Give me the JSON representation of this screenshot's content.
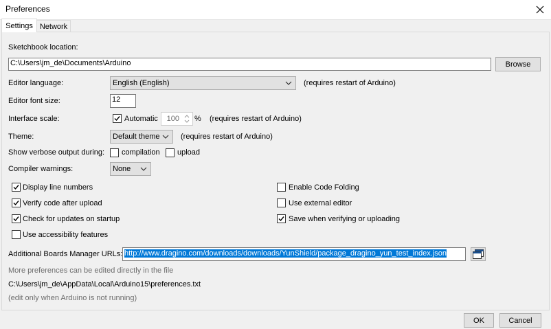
{
  "window": {
    "title": "Preferences"
  },
  "tabs": [
    {
      "label": "Settings",
      "active": true
    },
    {
      "label": "Network",
      "active": false
    }
  ],
  "settings": {
    "sketchbook_label": "Sketchbook location:",
    "sketchbook_path": "C:\\Users\\jm_de\\Documents\\Arduino",
    "browse_label": "Browse",
    "editor_language_label": "Editor language:",
    "editor_language_value": "English (English)",
    "restart_note": "(requires restart of Arduino)",
    "font_size_label": "Editor font size:",
    "font_size_value": "12",
    "interface_scale_label": "Interface scale:",
    "automatic_label": "Automatic",
    "automatic_checked": true,
    "scale_value": "100",
    "percent": "%",
    "theme_label": "Theme:",
    "theme_value": "Default theme",
    "verbose_label": "Show verbose output during:",
    "compilation_label": "compilation",
    "upload_label": "upload",
    "compiler_warnings_label": "Compiler warnings:",
    "compiler_warnings_value": "None",
    "checkboxes_left": [
      {
        "label": "Display line numbers",
        "checked": true
      },
      {
        "label": "Verify code after upload",
        "checked": true
      },
      {
        "label": "Check for updates on startup",
        "checked": true
      },
      {
        "label": "Use accessibility features",
        "checked": false
      }
    ],
    "checkboxes_right": [
      {
        "label": "Enable Code Folding",
        "checked": false
      },
      {
        "label": "Use external editor",
        "checked": false
      },
      {
        "label": "Save when verifying or uploading",
        "checked": true
      }
    ],
    "boards_urls_label": "Additional Boards Manager URLs:",
    "boards_urls_value": "http://www.dragino.com/downloads/downloads/YunShield/package_dragino_yun_test_index.json",
    "more_prefs_note": "More preferences can be edited directly in the file",
    "prefs_path": "C:\\Users\\jm_de\\AppData\\Local\\Arduino15\\preferences.txt",
    "edit_note": "(edit only when Arduino is not running)"
  },
  "footer": {
    "ok_label": "OK",
    "cancel_label": "Cancel"
  }
}
